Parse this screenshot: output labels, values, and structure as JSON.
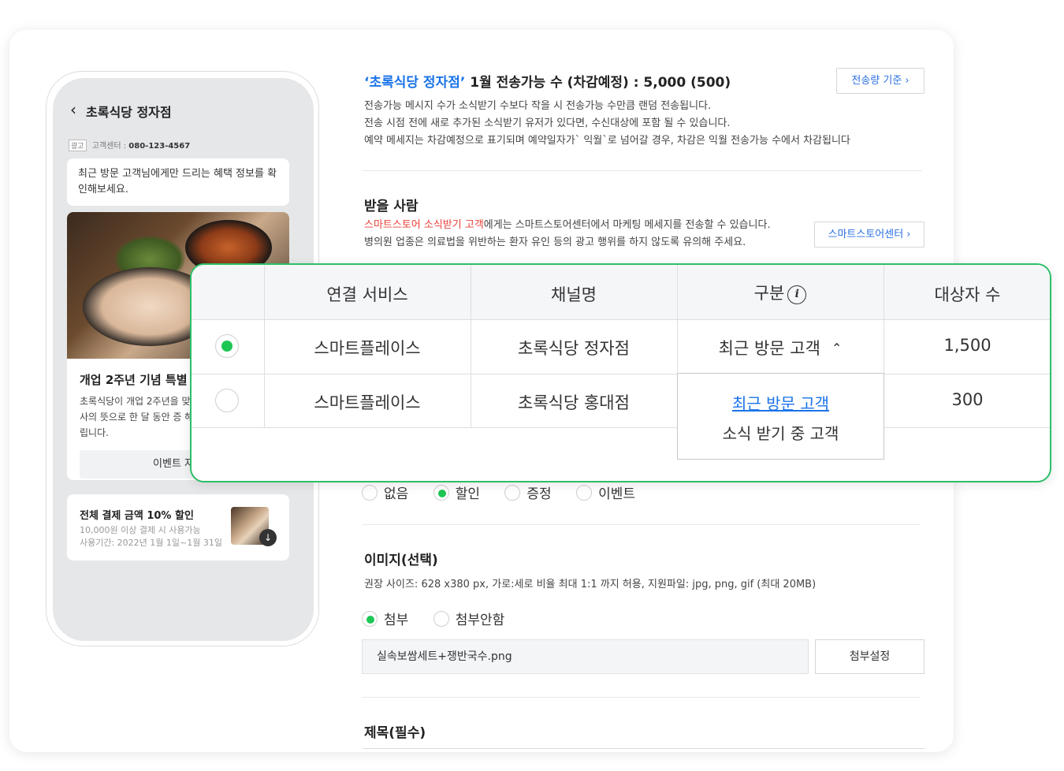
{
  "phone": {
    "back_icon": "‹",
    "title": "초록식당 정자점",
    "ad_tag": "광고",
    "ad_center_label": "고객센터 :",
    "ad_phone": "080-123-4567",
    "bubble": "최근 방문 고객님에게만 드리는 혜택 정보를 확인해보세요.",
    "card_title": "개업 2주년 기념 특별",
    "card_text": "초록식당이 개업 2주년을 맞 감사의 뜻으로 한 달 동안 증 해드립니다.",
    "card_button": "이벤트 자세",
    "coupon_title": "전체 결제 금액 10% 할인",
    "coupon_line1": "10,000원 이상 결제 시 사용가능",
    "coupon_line2": "사용기간: 2022년 1월 1일~1월 31일",
    "download_icon": "↓"
  },
  "send": {
    "store_quote": "‘초록식당 정자점’",
    "title_rest": " 1월 전송가능 수 (차감예정) : 5,000 (500)",
    "basis_button": "전송량 기준 ›",
    "desc1": "전송가능 메시지 수가 소식받기 수보다 작을 시 전송가능 수만큼 랜덤 전송됩니다.",
    "desc2": "전송 시점 전에 새로 추가된 소식받기 유저가 있다면, 수신대상에 포함 될 수 있습니다.",
    "desc3": "예약 메세지는 차감예정으로 표기되며 예약일자가` 익월`로 넘어갈 경우, 차감은 익월 전송가능 수에서 차감됩니다"
  },
  "recipients": {
    "title": "받을 사람",
    "red_text": "스마트스토어 소식받기 고객",
    "desc1_rest": "에게는 스마트스토어센터에서 마케팅 메세지를 전송할 수 있습니다.",
    "desc2": "병의원 업종은 의료법을 위반하는 환자 유인 등의 광고 행위를 하지 않도록 유의해 주세요.",
    "store_center_button": "스마트스토어센터 ›"
  },
  "table": {
    "headers": [
      "연결 서비스",
      "채널명",
      "구분",
      "대상자 수"
    ],
    "info_icon": "i",
    "rows": [
      {
        "service": "스마트플레이스",
        "channel": "초록식당 정자점",
        "type": "최근 방문 고객",
        "count": "1,500",
        "selected": true
      },
      {
        "service": "스마트플레이스",
        "channel": "초록식당 홍대점",
        "count": "300",
        "selected": false
      }
    ],
    "chevron_up_icon": "⌃",
    "dropdown_options": [
      "최근 방문 고객",
      "소식 받기 중 고객"
    ]
  },
  "benefit": {
    "options": [
      "없음",
      "할인",
      "증정",
      "이벤트"
    ],
    "selected": "할인"
  },
  "image": {
    "title": "이미지(선택)",
    "desc": "권장 사이즈: 628 x380 px, 가로:세로 비율 최대 1:1 까지 허용, 지원파일: jpg, png, gif (최대 20MB)",
    "options": [
      "첨부",
      "첨부안함"
    ],
    "selected": "첨부",
    "file_name": "실속보쌈세트+쟁반국수.png",
    "settings_button": "첨부설정"
  },
  "subject": {
    "title": "제목(필수)"
  },
  "colors": {
    "accent_green": "#1ec654",
    "border_green": "#2dbf68",
    "link_blue": "#1a73e8",
    "alert_red": "#e8413a"
  }
}
